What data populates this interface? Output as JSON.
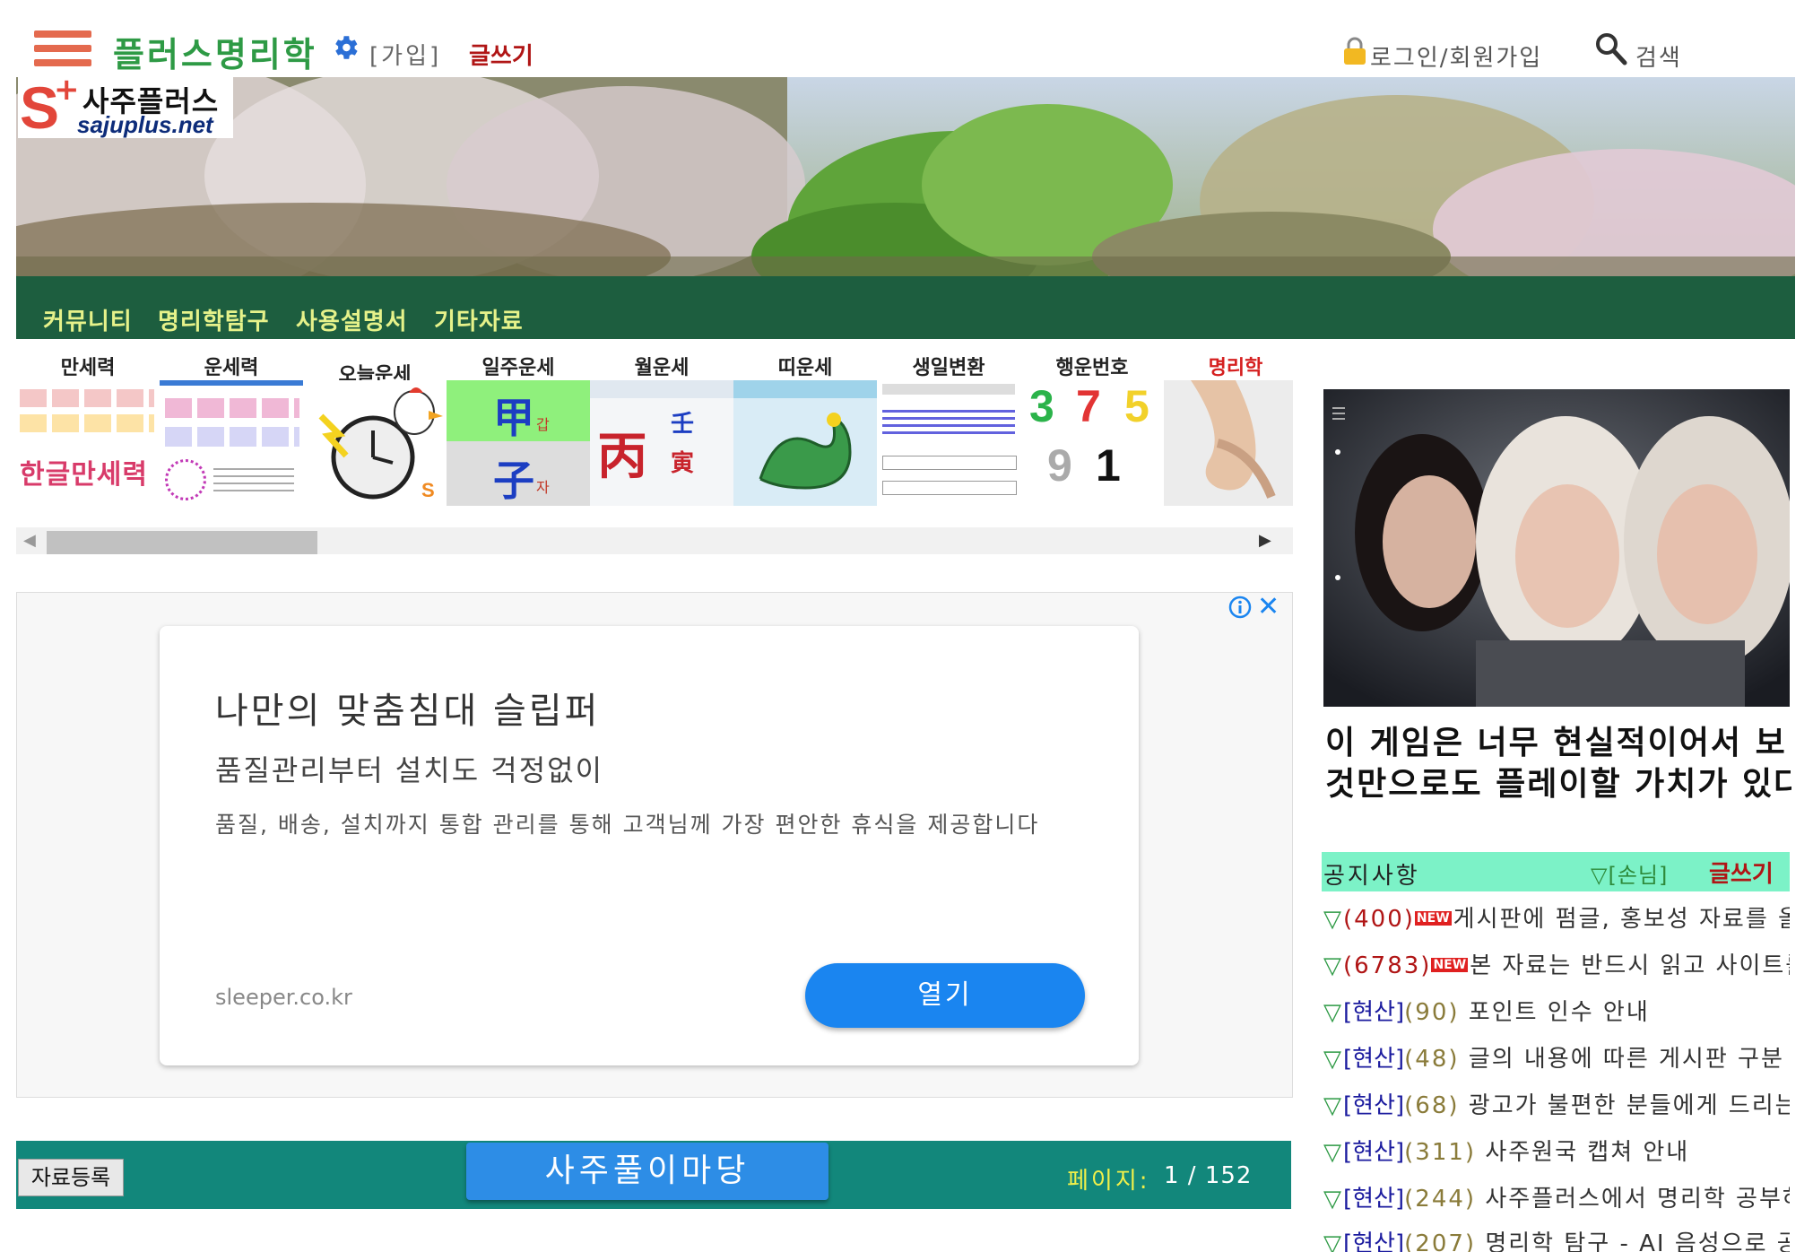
{
  "header": {
    "site_title": "플러스명리학",
    "join_label": "[가입]",
    "write_label": "글쓰기",
    "login_label": "로그인/회원가입",
    "search_label": "검색"
  },
  "logo": {
    "mark": "S",
    "plus": "+",
    "name_kr": "사주플러스",
    "domain": "sajuplus.net"
  },
  "nav": {
    "items": [
      "커뮤니티",
      "명리학탐구",
      "사용설명서",
      "기타자료"
    ]
  },
  "tools": [
    {
      "label": "만세력",
      "thumb_text": "한글만세력"
    },
    {
      "label": "운세력"
    },
    {
      "label": "오늘운세"
    },
    {
      "label": "일주운세",
      "glyphs": [
        "甲",
        "子"
      ],
      "small": [
        "갑",
        "자"
      ]
    },
    {
      "label": "월운세",
      "glyphs": [
        "丙",
        "壬",
        "寅"
      ]
    },
    {
      "label": "띠운세"
    },
    {
      "label": "생일변환"
    },
    {
      "label": "행운번호",
      "numbers": [
        "3",
        "7",
        "5",
        "9",
        "1"
      ]
    },
    {
      "label": "명리학"
    }
  ],
  "ad": {
    "headline": "나만의 맞춤침대 슬립퍼",
    "subheadline": "품질관리부터 설치도 걱정없이",
    "body": "품질, 배송, 설치까지 통합 관리를 통해 고객님께 가장 편안한 휴식을 제공합니다",
    "domain": "sleeper.co.kr",
    "cta": "열기"
  },
  "board": {
    "register_label": "자료등록",
    "title": "사주풀이마당",
    "page_label": "페이지:",
    "page_value": "1 / 152"
  },
  "sidebar": {
    "promo_headline_line1": "이 게임은 너무 현실적이어서 보",
    "promo_headline_line2": "것만으로도 플레이할 가치가 있다",
    "notice_title": "공지사항",
    "notice_guest": "▽[손님]",
    "notice_write": "글쓰기",
    "notices": [
      {
        "count": "(400)",
        "badge": "NEW",
        "category": "",
        "title": "게시판에 펌글, 홍보성 자료를 올"
      },
      {
        "count": "(6783)",
        "badge": "NEW",
        "category": "",
        "title": "본 자료는 반드시 읽고 사이트를"
      },
      {
        "count": "(90)",
        "badge": "",
        "category": "[현산]",
        "title": "포인트 인수 안내"
      },
      {
        "count": "(48)",
        "badge": "",
        "category": "[현산]",
        "title": "글의 내용에 따른 게시판 구분"
      },
      {
        "count": "(68)",
        "badge": "",
        "category": "[현산]",
        "title": "광고가 불편한 분들에게 드리는"
      },
      {
        "count": "(311)",
        "badge": "",
        "category": "[현산]",
        "title": "사주원국 캡쳐 안내"
      },
      {
        "count": "(244)",
        "badge": "",
        "category": "[현산]",
        "title": "사주플러스에서 명리학 공부하"
      },
      {
        "count": "(207)",
        "badge": "",
        "category": "[현산]",
        "title": "명리학 탐구 - AI 음성으로 공"
      }
    ]
  },
  "colors": {
    "brand_green": "#2e9a45",
    "nav_bg": "#1d5e3f",
    "board_bar": "#12877b",
    "accent_red": "#b01515",
    "cta_blue": "#1a85f0"
  },
  "icons": [
    "menu-icon",
    "gear-icon",
    "lock-icon",
    "search-icon",
    "ad-info-icon",
    "close-icon"
  ]
}
